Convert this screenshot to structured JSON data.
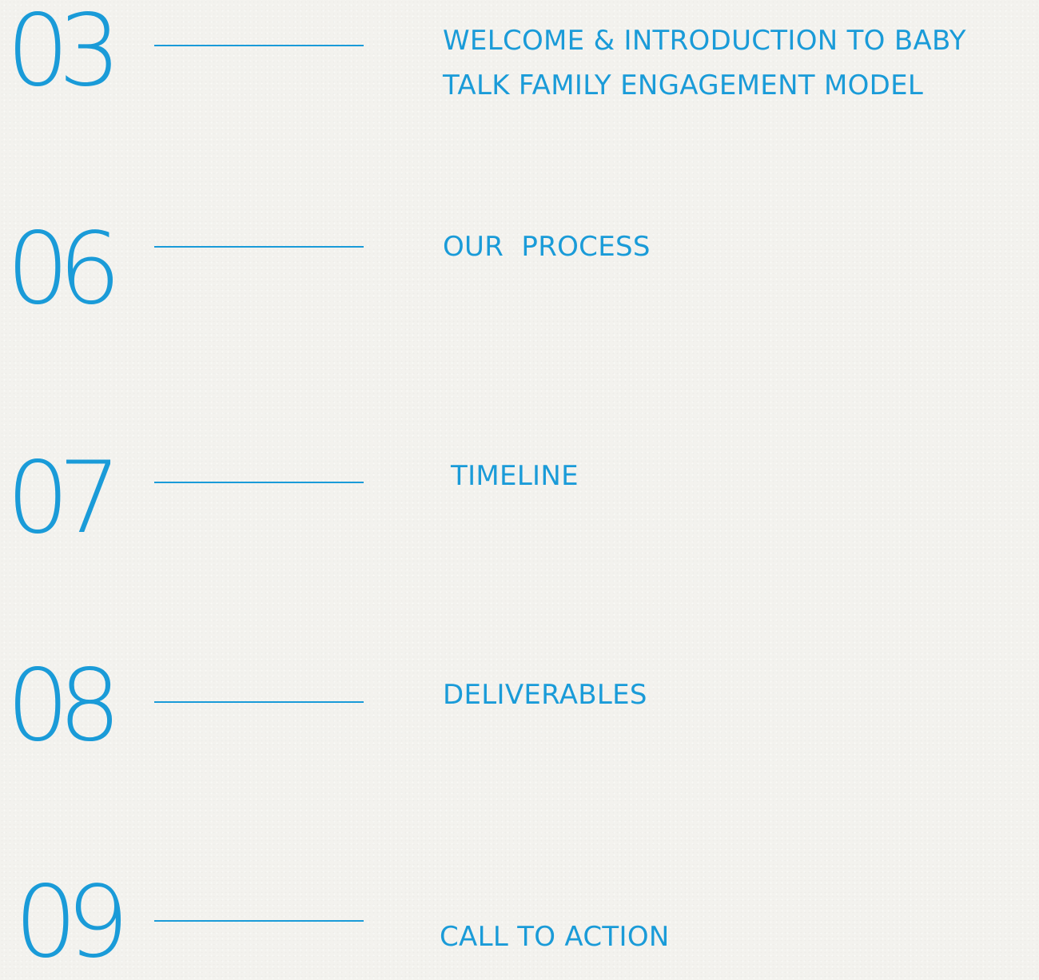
{
  "colors": {
    "accent": "#1a9bd8",
    "background": "#f3f2ee"
  },
  "toc": {
    "entries": [
      {
        "number": "03",
        "title": "WELCOME & INTRODUCTION TO BABY\nTALK FAMILY ENGAGEMENT MODEL"
      },
      {
        "number": "06",
        "title": "OUR  PROCESS"
      },
      {
        "number": "07",
        "title": "TIMELINE"
      },
      {
        "number": "08",
        "title": "DELIVERABLES"
      },
      {
        "number": "09",
        "title": "CALL TO ACTION"
      }
    ]
  }
}
